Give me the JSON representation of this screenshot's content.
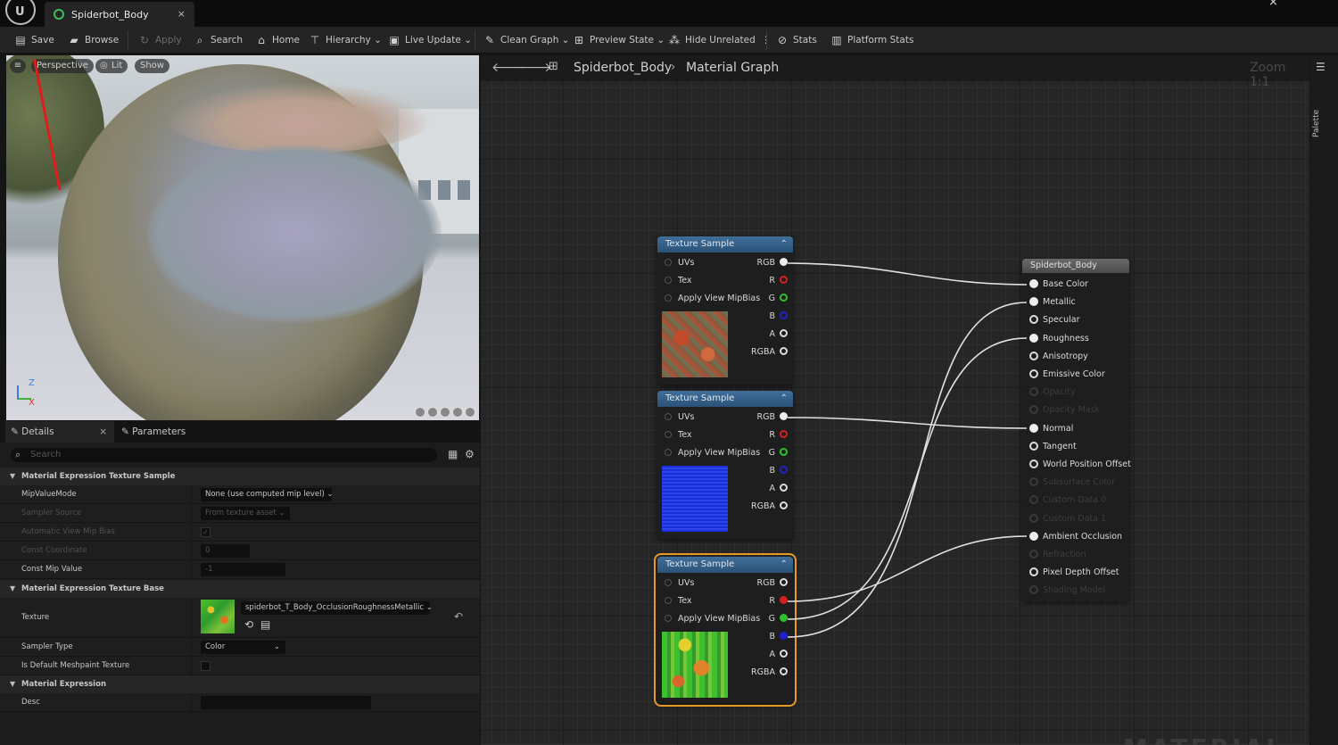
{
  "window": {
    "tab_title": "Spiderbot_Body",
    "tab_close": "×",
    "close": "×"
  },
  "toolbar": {
    "save": "Save",
    "browse": "Browse",
    "apply": "Apply",
    "search": "Search",
    "home": "Home",
    "hierarchy": "Hierarchy",
    "live_update": "Live Update",
    "clean_graph": "Clean Graph",
    "preview_state": "Preview State",
    "hide_unrelated": "Hide Unrelated",
    "stats": "Stats",
    "platform_stats": "Platform Stats"
  },
  "viewport": {
    "perspective": "Perspective",
    "lit": "Lit",
    "show": "Show",
    "axis_z": "Z",
    "axis_x": "X"
  },
  "details": {
    "tab_details": "Details",
    "tab_parameters": "Parameters",
    "search_placeholder": "Search",
    "sections": {
      "texture_sample": "Material Expression Texture Sample",
      "texture_base": "Material Expression Texture Base",
      "expression": "Material Expression"
    },
    "props": {
      "mip_value_mode": {
        "name": "MipValueMode",
        "value": "None (use computed mip level)"
      },
      "sampler_source": {
        "name": "Sampler Source",
        "value": "From texture asset"
      },
      "auto_view_mip_bias": {
        "name": "Automatic View Mip Bias",
        "checked": true
      },
      "const_coordinate": {
        "name": "Const Coordinate",
        "value": "0"
      },
      "const_mip_value": {
        "name": "Const Mip Value",
        "value": "-1"
      },
      "texture": {
        "name": "Texture",
        "value": "spiderbot_T_Body_OcclusionRoughnessMetallic"
      },
      "sampler_type": {
        "name": "Sampler Type",
        "value": "Color"
      },
      "is_default_meshpaint": {
        "name": "Is Default Meshpaint Texture",
        "checked": false
      },
      "desc": {
        "name": "Desc",
        "value": ""
      }
    }
  },
  "graph": {
    "breadcrumb_asset": "Spiderbot_Body",
    "breadcrumb_graph": "Material Graph",
    "zoom": "Zoom 1:1",
    "palette": "Palette",
    "watermark": "MATERIAL",
    "texture_nodes": [
      {
        "title": "Texture Sample",
        "inputs": [
          "UVs",
          "Tex",
          "Apply View MipBias"
        ],
        "outputs": [
          "RGB",
          "R",
          "G",
          "B",
          "A",
          "RGBA"
        ],
        "preview": "orange-red base color texture"
      },
      {
        "title": "Texture Sample",
        "inputs": [
          "UVs",
          "Tex",
          "Apply View MipBias"
        ],
        "outputs": [
          "RGB",
          "R",
          "G",
          "B",
          "A",
          "RGBA"
        ],
        "preview": "blue normal map texture"
      },
      {
        "title": "Texture Sample",
        "inputs": [
          "UVs",
          "Tex",
          "Apply View MipBias"
        ],
        "outputs": [
          "RGB",
          "R",
          "G",
          "B",
          "A",
          "RGBA"
        ],
        "preview": "green ORM texture",
        "selected": true
      }
    ],
    "material_node": {
      "title": "Spiderbot_Body",
      "pins": [
        {
          "label": "Base Color",
          "connected": true,
          "enabled": true
        },
        {
          "label": "Metallic",
          "connected": true,
          "enabled": true
        },
        {
          "label": "Specular",
          "connected": false,
          "enabled": true
        },
        {
          "label": "Roughness",
          "connected": true,
          "enabled": true
        },
        {
          "label": "Anisotropy",
          "connected": false,
          "enabled": true
        },
        {
          "label": "Emissive Color",
          "connected": false,
          "enabled": true
        },
        {
          "label": "Opacity",
          "connected": false,
          "enabled": false
        },
        {
          "label": "Opacity Mask",
          "connected": false,
          "enabled": false
        },
        {
          "label": "Normal",
          "connected": true,
          "enabled": true
        },
        {
          "label": "Tangent",
          "connected": false,
          "enabled": true
        },
        {
          "label": "World Position Offset",
          "connected": false,
          "enabled": true
        },
        {
          "label": "Subsurface Color",
          "connected": false,
          "enabled": false
        },
        {
          "label": "Custom Data 0",
          "connected": false,
          "enabled": false
        },
        {
          "label": "Custom Data 1",
          "connected": false,
          "enabled": false
        },
        {
          "label": "Ambient Occlusion",
          "connected": true,
          "enabled": true
        },
        {
          "label": "Refraction",
          "connected": false,
          "enabled": false
        },
        {
          "label": "Pixel Depth Offset",
          "connected": false,
          "enabled": true
        },
        {
          "label": "Shading Model",
          "connected": false,
          "enabled": false
        }
      ]
    }
  },
  "colors": {
    "accent_selected": "#e59a27",
    "pin_red": "#d62020",
    "pin_green": "#2ec02e",
    "pin_blue": "#2020c8",
    "node_header_blue": "#3f6f9a"
  }
}
